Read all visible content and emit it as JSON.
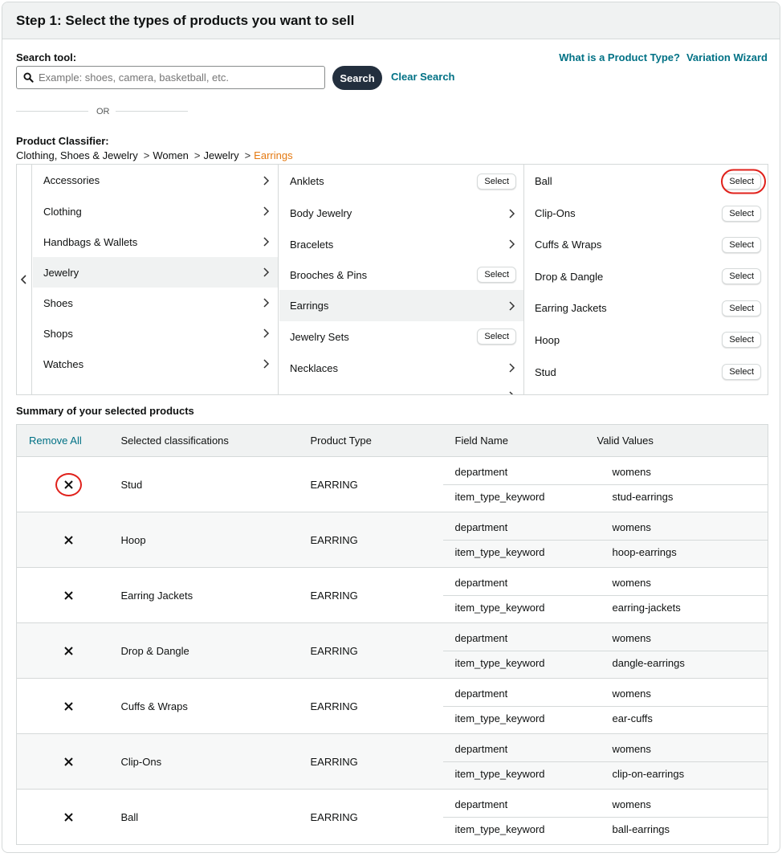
{
  "header": {
    "title": "Step 1: Select the types of products you want to sell"
  },
  "search": {
    "label": "Search tool:",
    "placeholder": "Example: shoes, camera, basketball, etc.",
    "button": "Search",
    "clear": "Clear Search"
  },
  "links": {
    "product_type": "What is a Product Type?",
    "variation_wizard": "Variation Wizard"
  },
  "or_text": "OR",
  "classifier": {
    "label": "Product Classifier:",
    "breadcrumb": [
      "Clothing, Shoes & Jewelry",
      "Women",
      "Jewelry"
    ],
    "breadcrumb_current": "Earrings",
    "select_label": "Select",
    "col1": [
      "Accessories",
      "Clothing",
      "Handbags & Wallets",
      "Jewelry",
      "Shoes",
      "Shops",
      "Watches"
    ],
    "col2": [
      "Anklets",
      "Body Jewelry",
      "Bracelets",
      "Brooches & Pins",
      "Earrings",
      "Jewelry Sets",
      "Necklaces"
    ],
    "col3": [
      "Ball",
      "Clip-Ons",
      "Cuffs & Wraps",
      "Drop & Dangle",
      "Earring Jackets",
      "Hoop",
      "Stud"
    ]
  },
  "summary": {
    "title": "Summary of your selected products",
    "headers": {
      "remove_all": "Remove All",
      "classification": "Selected classifications",
      "product_type": "Product Type",
      "field_name": "Field Name",
      "valid_values": "Valid Values"
    },
    "rows": [
      {
        "classification": "Stud",
        "product_type": "EARRING",
        "fields": [
          {
            "name": "department",
            "value": "womens"
          },
          {
            "name": "item_type_keyword",
            "value": "stud-earrings"
          }
        ]
      },
      {
        "classification": "Hoop",
        "product_type": "EARRING",
        "fields": [
          {
            "name": "department",
            "value": "womens"
          },
          {
            "name": "item_type_keyword",
            "value": "hoop-earrings"
          }
        ]
      },
      {
        "classification": "Earring Jackets",
        "product_type": "EARRING",
        "fields": [
          {
            "name": "department",
            "value": "womens"
          },
          {
            "name": "item_type_keyword",
            "value": "earring-jackets"
          }
        ]
      },
      {
        "classification": "Drop & Dangle",
        "product_type": "EARRING",
        "fields": [
          {
            "name": "department",
            "value": "womens"
          },
          {
            "name": "item_type_keyword",
            "value": "dangle-earrings"
          }
        ]
      },
      {
        "classification": "Cuffs & Wraps",
        "product_type": "EARRING",
        "fields": [
          {
            "name": "department",
            "value": "womens"
          },
          {
            "name": "item_type_keyword",
            "value": "ear-cuffs"
          }
        ]
      },
      {
        "classification": "Clip-Ons",
        "product_type": "EARRING",
        "fields": [
          {
            "name": "department",
            "value": "womens"
          },
          {
            "name": "item_type_keyword",
            "value": "clip-on-earrings"
          }
        ]
      },
      {
        "classification": "Ball",
        "product_type": "EARRING",
        "fields": [
          {
            "name": "department",
            "value": "womens"
          },
          {
            "name": "item_type_keyword",
            "value": "ball-earrings"
          }
        ]
      }
    ]
  }
}
